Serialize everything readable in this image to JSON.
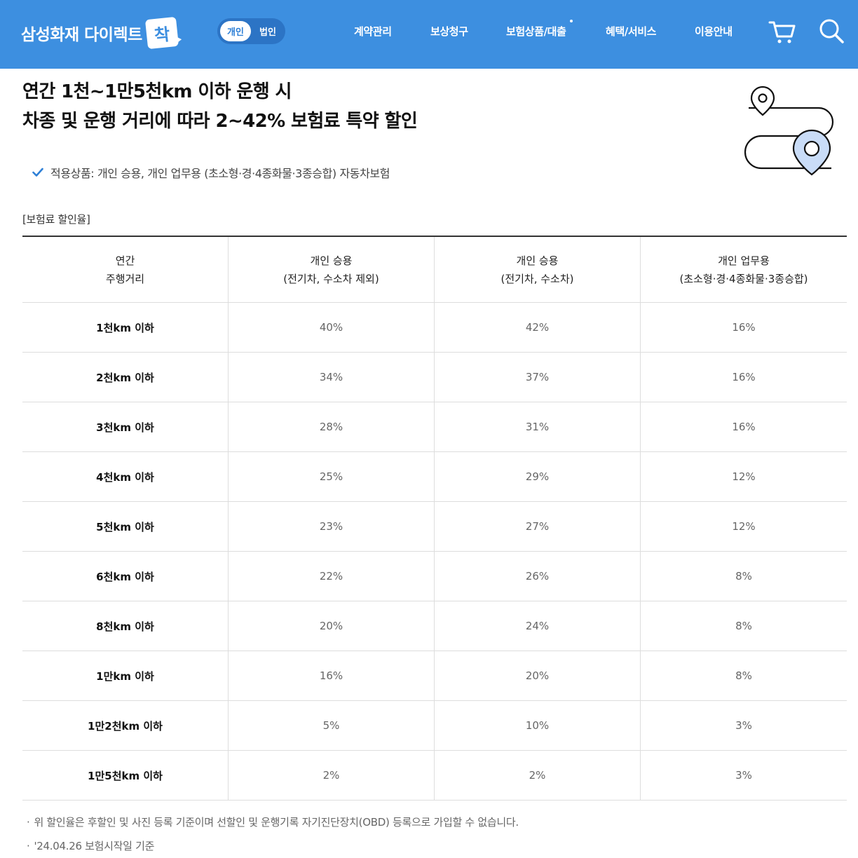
{
  "header": {
    "brand": "삼성화재 다이렉트",
    "brand_badge": "착",
    "toggle": {
      "active": "개인",
      "inactive": "법인"
    },
    "nav": [
      "계약관리",
      "보상청구",
      "보험상품/대출",
      "혜택/서비스",
      "이용안내"
    ],
    "icons": [
      "cart-icon",
      "search-icon"
    ]
  },
  "hero": {
    "title_line1": "연간 1천~1만5천km 이하 운행 시",
    "title_line2": "차종 및 운행 거리에 따라 2~42% 보험료 특약 할인",
    "applied": "적용상품: 개인 승용, 개인 업무용 (초소형·경·4종화물·3종승합) 자동차보험"
  },
  "table": {
    "label": "[보험료 할인율]",
    "headers": [
      [
        "연간",
        "주행거리"
      ],
      [
        "개인 승용",
        "(전기차, 수소차 제외)"
      ],
      [
        "개인 승용",
        "(전기차, 수소차)"
      ],
      [
        "개인 업무용",
        "(초소형·경·4종화물·3종승합)"
      ]
    ],
    "rows": [
      [
        "1천km 이하",
        "40%",
        "42%",
        "16%"
      ],
      [
        "2천km 이하",
        "34%",
        "37%",
        "16%"
      ],
      [
        "3천km 이하",
        "28%",
        "31%",
        "16%"
      ],
      [
        "4천km 이하",
        "25%",
        "29%",
        "12%"
      ],
      [
        "5천km 이하",
        "23%",
        "27%",
        "12%"
      ],
      [
        "6천km 이하",
        "22%",
        "26%",
        "8%"
      ],
      [
        "8천km 이하",
        "20%",
        "24%",
        "8%"
      ],
      [
        "1만km 이하",
        "16%",
        "20%",
        "8%"
      ],
      [
        "1만2천km 이하",
        "5%",
        "10%",
        "3%"
      ],
      [
        "1만5천km 이하",
        "2%",
        "2%",
        "3%"
      ]
    ]
  },
  "notes": [
    "위 할인율은 후할인 및 사진 등록 기준이며 선할인 및 운행기록 자기진단장치(OBD) 등록으로 가입할 수 없습니다.",
    "'24.04.26 보험시작일 기준"
  ],
  "colors": {
    "header_bg": "#3d8fe0",
    "accent": "#2d7fd6"
  }
}
